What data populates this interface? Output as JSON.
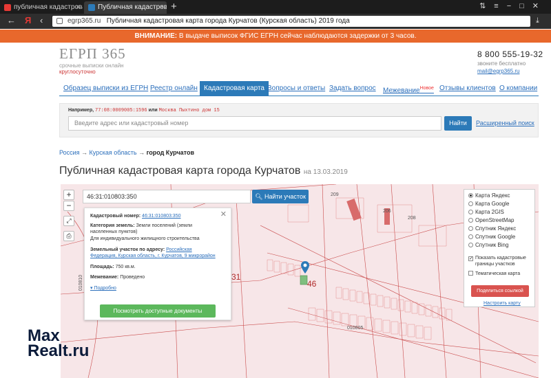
{
  "browser": {
    "tabs": [
      {
        "title": "публичная кадастровая ка",
        "favicon_color": "#e53935"
      },
      {
        "title": "Публичная кадастрова",
        "favicon_color": "#2c7ab8"
      }
    ],
    "new_tab": "+",
    "url_domain": "egrp365.ru",
    "url_title": "Публичная кадастровая карта города Курчатов (Курская область) 2019 года"
  },
  "warning": {
    "strong": "ВНИМАНИЕ:",
    "text": "В выдаче выписок ФГИС ЕГРН сейчас наблюдаются задержки от 3 часов."
  },
  "logo": {
    "name": "ЕГРП 365",
    "tagline1": "срочные выписки онлайн",
    "tagline2": "круглосуточно"
  },
  "contact": {
    "phone": "8 800 555-19-32",
    "call_free": "звоните бесплатно",
    "email": "mail@egrp365.ru"
  },
  "menu": [
    {
      "label": "Образец выписки из ЕГРН"
    },
    {
      "label": "Реестр онлайн"
    },
    {
      "label": "Кадастровая карта",
      "active": true
    },
    {
      "label": "Вопросы и ответы"
    },
    {
      "label": "Задать вопрос"
    },
    {
      "label": "Межевание",
      "badge": "Новое"
    },
    {
      "label": "Отзывы клиентов"
    },
    {
      "label": "О компании"
    }
  ],
  "search": {
    "example_prefix": "Например,",
    "example_code": "77:08:0009005:1596",
    "example_or": "или",
    "example_addr": "Москва Пыхтино дом 15",
    "placeholder": "Введите адрес или кадастровый номер",
    "button": "Найти",
    "advanced": "Расширенный поиск"
  },
  "breadcrumb": {
    "root": "Россия",
    "sep": "→",
    "region": "Курская область",
    "city": "город Курчатов"
  },
  "page": {
    "title": "Публичная кадастровая карта города Курчатов",
    "date": "на 13.03.2019"
  },
  "map": {
    "zoom_in": "+",
    "zoom_out": "−",
    "cadastral_input": "46:31:010803:350",
    "find_button": "Найти участок",
    "labels": {
      "l46": "46",
      "l31": "31",
      "n010805": "010805",
      "n010810": "010810",
      "n208": "208",
      "n206": "206",
      "n209": "209"
    },
    "popup": {
      "cad_label": "Кадастровый номер:",
      "cad_value": "46:31:010803:350",
      "cat_label": "Категория земель:",
      "cat_value1": "Земли поселений (земли",
      "cat_value2": "населенных пунктов)",
      "use_value": "Для индивидуального жилищного строительства",
      "addr_label": "Земельный участок по адресу:",
      "addr_value1": "Российская",
      "addr_value2": "Федерация, Курская область, г. Курчатов, 9 микрорайон",
      "area_label": "Площадь:",
      "area_value": "750 кв.м.",
      "survey_label": "Межевание:",
      "survey_value": "Проведено",
      "more": "Подробно",
      "docs_button": "Посмотреть доступные документы",
      "close": "✕"
    },
    "layers": [
      {
        "label": "Карта Яндекс",
        "selected": true
      },
      {
        "label": "Карта Google",
        "selected": false
      },
      {
        "label": "Карта 2GIS",
        "selected": false
      },
      {
        "label": "OpenStreetMap",
        "selected": false
      },
      {
        "label": "Спутник Яндекс",
        "selected": false
      },
      {
        "label": "Спутник Google",
        "selected": false
      },
      {
        "label": "Спутник Bing",
        "selected": false
      }
    ],
    "show_borders1": "Показать кадастровые",
    "show_borders2": "границы участков",
    "thematic": "Тематическая карта",
    "share_button": "Поделиться ссылкой",
    "setup_map": "Настроить карту"
  },
  "watermark": {
    "line1": "Max",
    "line2": "Realt.ru"
  }
}
